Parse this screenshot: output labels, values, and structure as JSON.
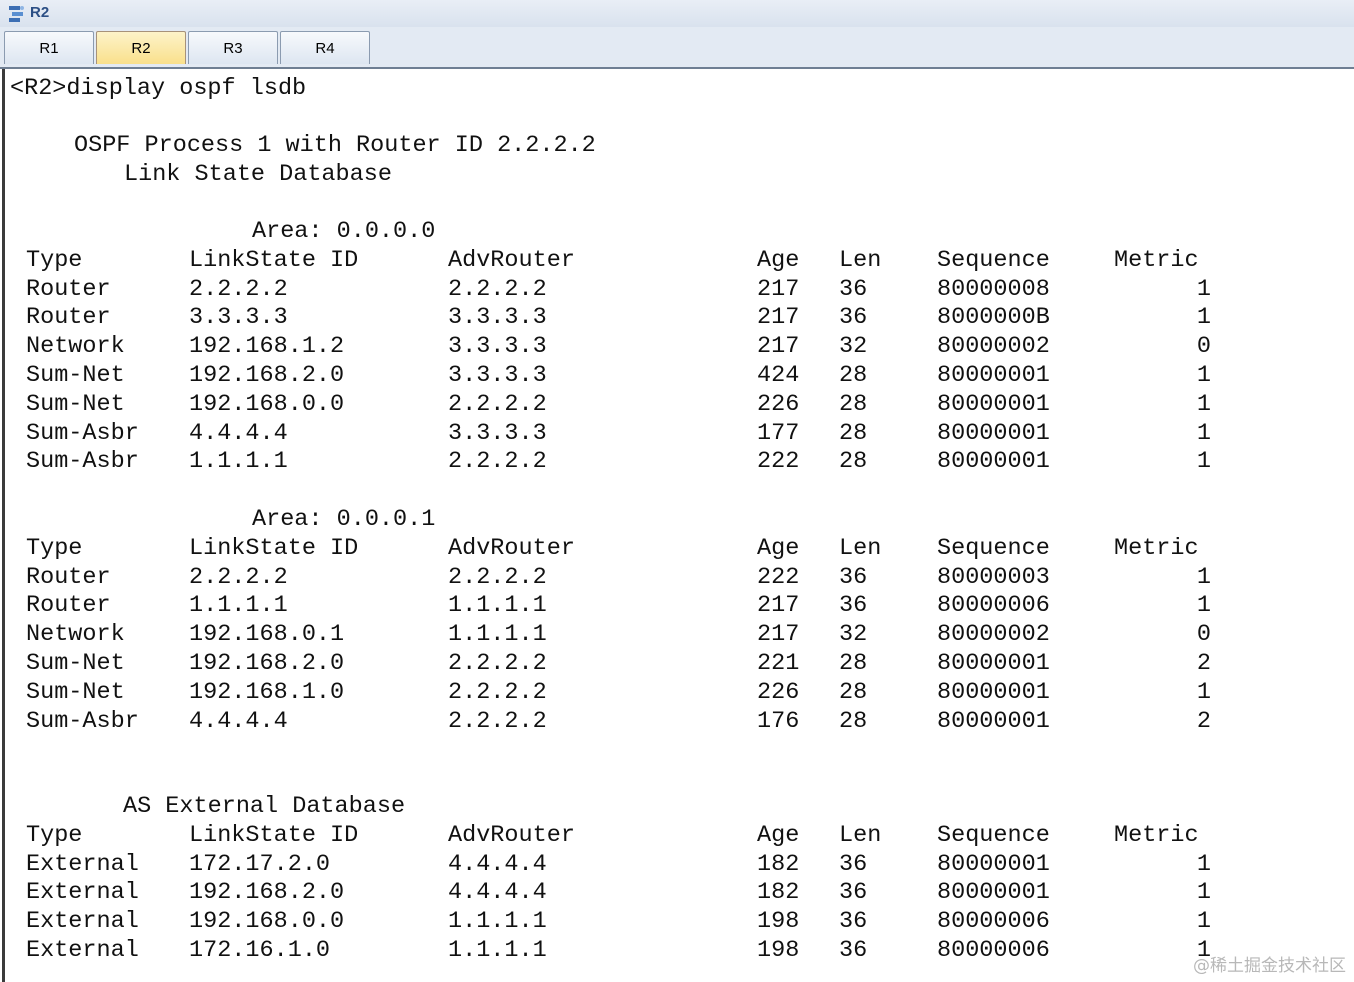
{
  "window": {
    "title": "R2"
  },
  "tabs": [
    {
      "label": "R1",
      "active": false
    },
    {
      "label": "R2",
      "active": true
    },
    {
      "label": "R3",
      "active": false
    },
    {
      "label": "R4",
      "active": false
    }
  ],
  "console": {
    "command": "<R2>display ospf lsdb",
    "header1": "OSPF Process 1 with Router ID 2.2.2.2",
    "header2": "Link State Database",
    "columns": [
      "Type",
      "LinkState ID",
      "AdvRouter",
      "Age",
      "Len",
      "Sequence",
      "Metric"
    ],
    "sections": [
      {
        "title": "Area: 0.0.0.0",
        "rows": [
          [
            "Router",
            "2.2.2.2",
            "2.2.2.2",
            "217",
            "36",
            "80000008",
            "1"
          ],
          [
            "Router",
            "3.3.3.3",
            "3.3.3.3",
            "217",
            "36",
            "8000000B",
            "1"
          ],
          [
            "Network",
            "192.168.1.2",
            "3.3.3.3",
            "217",
            "32",
            "80000002",
            "0"
          ],
          [
            "Sum-Net",
            "192.168.2.0",
            "3.3.3.3",
            "424",
            "28",
            "80000001",
            "1"
          ],
          [
            "Sum-Net",
            "192.168.0.0",
            "2.2.2.2",
            "226",
            "28",
            "80000001",
            "1"
          ],
          [
            "Sum-Asbr",
            "4.4.4.4",
            "3.3.3.3",
            "177",
            "28",
            "80000001",
            "1"
          ],
          [
            "Sum-Asbr",
            "1.1.1.1",
            "2.2.2.2",
            "222",
            "28",
            "80000001",
            "1"
          ]
        ]
      },
      {
        "title": "Area: 0.0.0.1",
        "rows": [
          [
            "Router",
            "2.2.2.2",
            "2.2.2.2",
            "222",
            "36",
            "80000003",
            "1"
          ],
          [
            "Router",
            "1.1.1.1",
            "1.1.1.1",
            "217",
            "36",
            "80000006",
            "1"
          ],
          [
            "Network",
            "192.168.0.1",
            "1.1.1.1",
            "217",
            "32",
            "80000002",
            "0"
          ],
          [
            "Sum-Net",
            "192.168.2.0",
            "2.2.2.2",
            "221",
            "28",
            "80000001",
            "2"
          ],
          [
            "Sum-Net",
            "192.168.1.0",
            "2.2.2.2",
            "226",
            "28",
            "80000001",
            "1"
          ],
          [
            "Sum-Asbr",
            "4.4.4.4",
            "2.2.2.2",
            "176",
            "28",
            "80000001",
            "2"
          ]
        ]
      },
      {
        "title": "AS External Database",
        "rows": [
          [
            "External",
            "172.17.2.0",
            "4.4.4.4",
            "182",
            "36",
            "80000001",
            "1"
          ],
          [
            "External",
            "192.168.2.0",
            "4.4.4.4",
            "182",
            "36",
            "80000001",
            "1"
          ],
          [
            "External",
            "192.168.0.0",
            "1.1.1.1",
            "198",
            "36",
            "80000006",
            "1"
          ],
          [
            "External",
            "172.16.1.0",
            "1.1.1.1",
            "198",
            "36",
            "80000006",
            "1"
          ]
        ]
      }
    ]
  },
  "watermark": "@稀土掘金技术社区",
  "icons": {
    "app": "router-app-icon"
  }
}
